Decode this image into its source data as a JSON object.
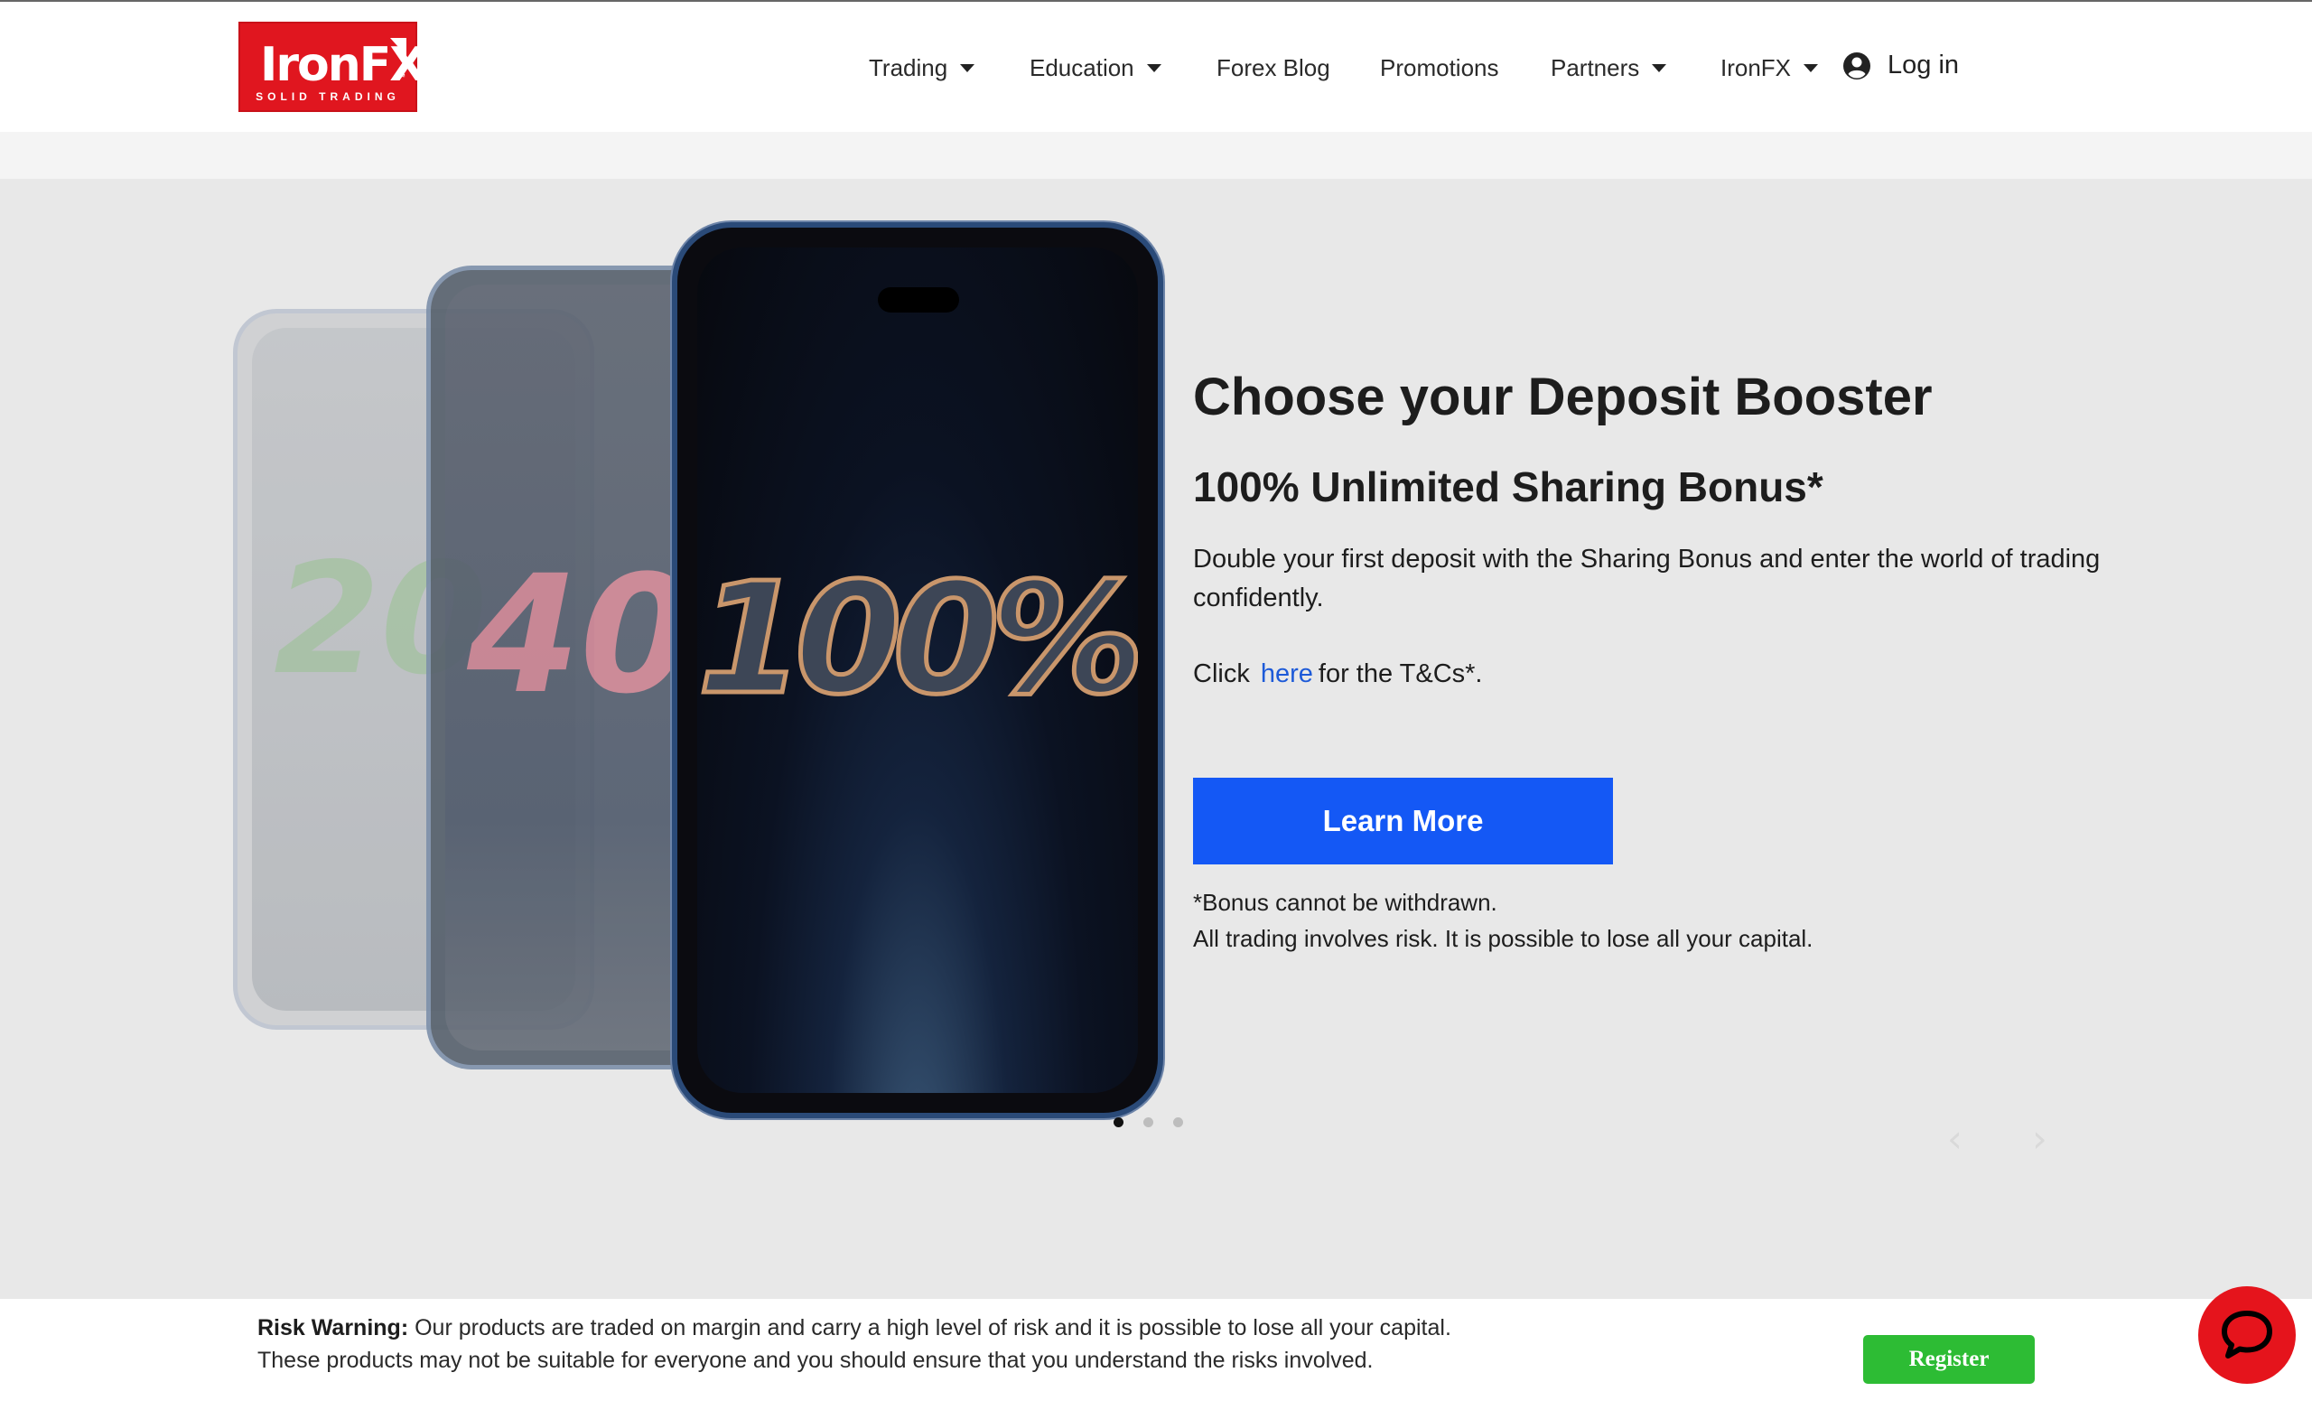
{
  "header": {
    "logo": {
      "brand": "IronFX",
      "tagline": "SOLID TRADING",
      "trademark": "™",
      "color": "#e0161f"
    },
    "nav": [
      {
        "label": "Trading",
        "dropdown": true
      },
      {
        "label": "Education",
        "dropdown": true
      },
      {
        "label": "Forex Blog",
        "dropdown": false
      },
      {
        "label": "Promotions",
        "dropdown": false
      },
      {
        "label": "Partners",
        "dropdown": true
      },
      {
        "label": "IronFX",
        "dropdown": true
      }
    ],
    "login_label": "Log in",
    "login_icon": "user-circle-icon"
  },
  "hero": {
    "phones": [
      {
        "number": "20",
        "tint": "#7fae7a"
      },
      {
        "number": "40",
        "tint": "#c77a88"
      },
      {
        "number": "100%",
        "tint": "#c9966b"
      }
    ],
    "headline": "Choose your Deposit Booster",
    "subheadline": "100% Unlimited Sharing Bonus*",
    "description": "Double your first deposit with the Sharing Bonus and enter the world of trading confidently.",
    "tc_prefix": "Click",
    "tc_link": "here",
    "tc_suffix": "for the T&Cs*.",
    "cta_label": "Learn More",
    "cta_color": "#1458f5",
    "disclaimer_1": "*Bonus cannot be withdrawn.",
    "disclaimer_2": "All trading involves risk. It is possible to lose all your capital.",
    "carousel": {
      "slides": 3,
      "active": 1,
      "prev_icon": "chevron-left-icon",
      "next_icon": "chevron-right-icon"
    }
  },
  "risk_bar": {
    "label": "Risk Warning:",
    "line_1": "Our products are traded on margin and carry a high level of risk and it is possible to lose all your capital.",
    "line_2": "These products may not be suitable for everyone and you should ensure that you understand the risks involved.",
    "register_label": "Register",
    "register_color": "#2dbc34"
  },
  "chat": {
    "icon": "chat-bubble-icon",
    "color": "#e5141c"
  }
}
